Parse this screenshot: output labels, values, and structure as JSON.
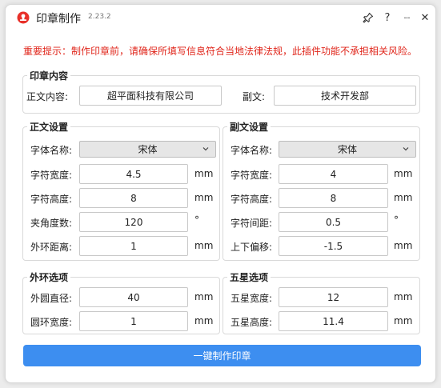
{
  "window": {
    "title": "印章制作",
    "version": "2.23.2"
  },
  "titlebar": {
    "pin_icon": "pin-icon",
    "help_label": "?",
    "more_label": "···",
    "close_label": "✕"
  },
  "warning": "重要提示：制作印章前，请确保所填写信息符合当地法律法规，此插件功能不承担相关风险。",
  "seal_content": {
    "title": "印章内容",
    "main_text_label": "正文内容:",
    "main_text_value": "超平面科技有限公司",
    "sub_text_label": "副文:",
    "sub_text_value": "技术开发部"
  },
  "main_settings": {
    "title": "正文设置",
    "font_label": "字体名称:",
    "font_value": "宋体",
    "char_width_label": "字符宽度:",
    "char_width_value": "4.5",
    "char_width_unit": "mm",
    "char_height_label": "字符高度:",
    "char_height_value": "8",
    "char_height_unit": "mm",
    "angle_label": "夹角度数:",
    "angle_value": "120",
    "angle_unit": "°",
    "ring_distance_label": "外环距离:",
    "ring_distance_value": "1",
    "ring_distance_unit": "mm"
  },
  "sub_settings": {
    "title": "副文设置",
    "font_label": "字体名称:",
    "font_value": "宋体",
    "char_width_label": "字符宽度:",
    "char_width_value": "4",
    "char_width_unit": "mm",
    "char_height_label": "字符高度:",
    "char_height_value": "8",
    "char_height_unit": "mm",
    "spacing_label": "字符间距:",
    "spacing_value": "0.5",
    "spacing_unit": "°",
    "offset_label": "上下偏移:",
    "offset_value": "-1.5",
    "offset_unit": "mm"
  },
  "ring_options": {
    "title": "外环选项",
    "diameter_label": "外圆直径:",
    "diameter_value": "40",
    "diameter_unit": "mm",
    "width_label": "圆环宽度:",
    "width_value": "1",
    "width_unit": "mm"
  },
  "star_options": {
    "title": "五星选项",
    "width_label": "五星宽度:",
    "width_value": "12",
    "width_unit": "mm",
    "height_label": "五星高度:",
    "height_value": "11.4",
    "height_unit": "mm"
  },
  "action": {
    "make_label": "一键制作印章"
  },
  "colors": {
    "accent": "#3d8ef0",
    "warning": "#e0261b",
    "icon_red": "#e8312a"
  }
}
